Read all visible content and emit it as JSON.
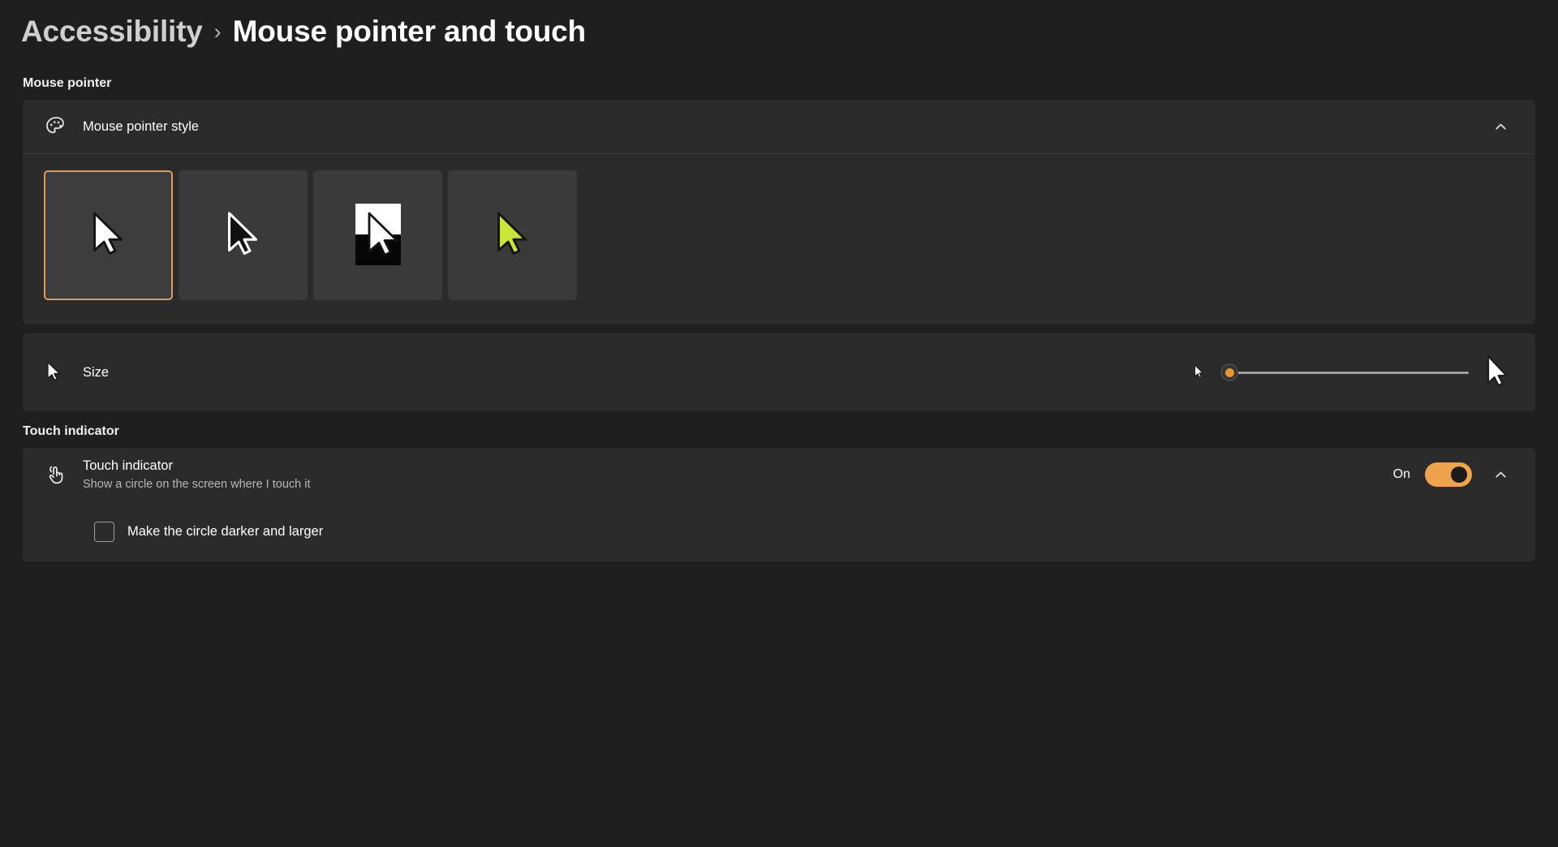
{
  "breadcrumb": {
    "parent": "Accessibility",
    "separator": "›",
    "current": "Mouse pointer and touch"
  },
  "sections": {
    "mouse_pointer": {
      "label": "Mouse pointer",
      "style_row": {
        "title": "Mouse pointer style",
        "icon": "palette-icon",
        "expand_icon": "chevron-up-icon",
        "expanded": true
      },
      "styles": [
        {
          "name": "white",
          "selected": true
        },
        {
          "name": "black",
          "selected": false
        },
        {
          "name": "inverted",
          "selected": false
        },
        {
          "name": "custom",
          "selected": false,
          "color": "#c8e633"
        }
      ],
      "size_row": {
        "title": "Size",
        "icon": "cursor-icon",
        "slider": {
          "value": 1,
          "min": 1,
          "max": 15,
          "thumb_color": "#e8962e",
          "left_icon": "small-cursor-icon",
          "right_icon": "large-cursor-icon"
        }
      }
    },
    "touch_indicator": {
      "label": "Touch indicator",
      "row": {
        "title": "Touch indicator",
        "subtitle": "Show a circle on the screen where I touch it",
        "icon": "touch-tap-icon",
        "toggle_state": "On",
        "toggle_on": true,
        "expand_icon": "chevron-up-icon"
      },
      "checkbox": {
        "label": "Make the circle darker and larger",
        "checked": false
      }
    }
  },
  "colors": {
    "page_background": "#1f1f1f",
    "card_background": "#2b2b2b",
    "swatch_background": "#3a3a3a",
    "accent_selection": "#e09b5a",
    "accent_toggle": "#efa34c",
    "accent_slider": "#e8962e"
  }
}
